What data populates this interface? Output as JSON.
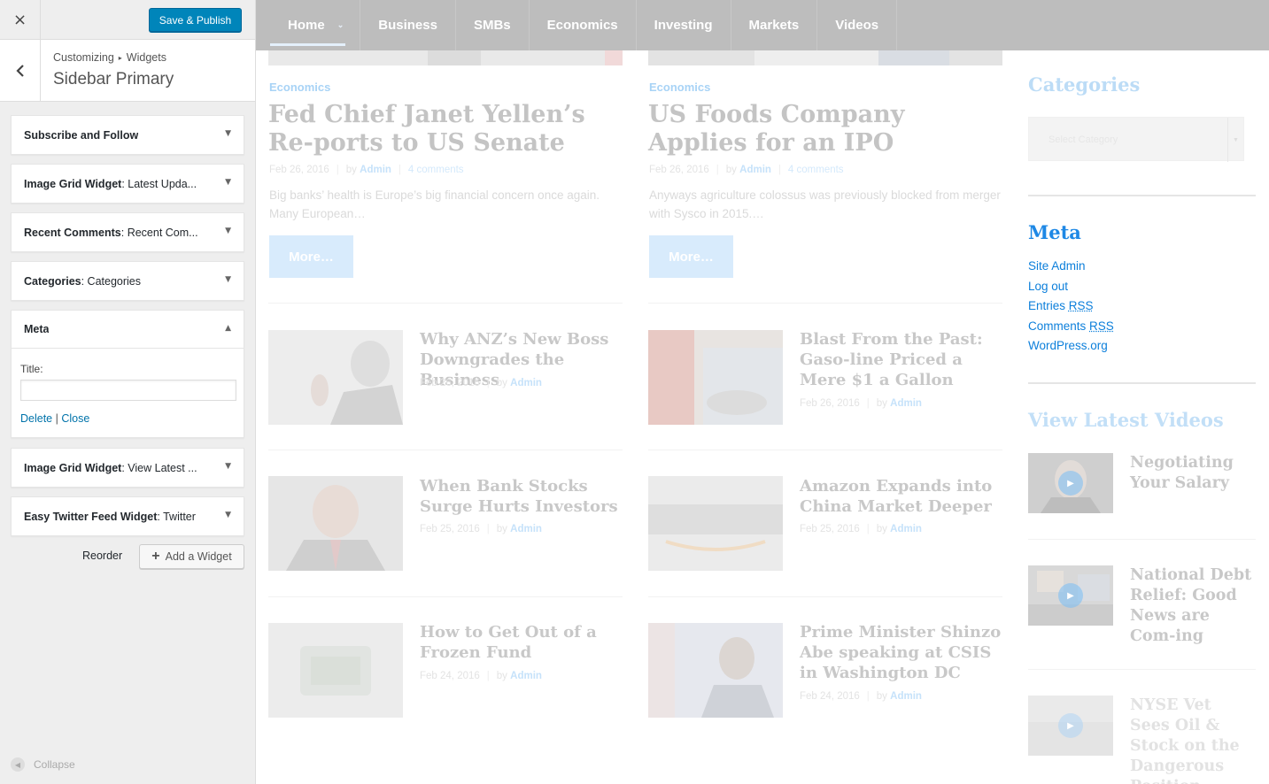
{
  "customizer": {
    "close_label": "×",
    "publish_label": "Save & Publish",
    "breadcrumb": {
      "root": "Customizing",
      "sep": "▸",
      "current": "Widgets"
    },
    "section_title": "Sidebar Primary",
    "widgets": [
      {
        "name": "Subscribe and Follow",
        "subtitle": ""
      },
      {
        "name": "Image Grid Widget",
        "subtitle": ": Latest Upda..."
      },
      {
        "name": "Recent Comments",
        "subtitle": ": Recent Com..."
      },
      {
        "name": "Categories",
        "subtitle": ": Categories"
      },
      {
        "name": "Meta",
        "subtitle": ""
      },
      {
        "name": "Image Grid Widget",
        "subtitle": ": View Latest ..."
      },
      {
        "name": "Easy Twitter Feed Widget",
        "subtitle": ": Twitter"
      }
    ],
    "meta_widget": {
      "title_label": "Title:",
      "title_value": "",
      "delete_label": "Delete",
      "divider": "|",
      "close_label": "Close"
    },
    "reorder_label": "Reorder",
    "add_widget_label": "Add a Widget",
    "collapse_label": "Collapse"
  },
  "nav": {
    "items": [
      "Home",
      "Business",
      "SMBs",
      "Economics",
      "Investing",
      "Markets",
      "Videos"
    ],
    "active": "Home"
  },
  "featured": [
    {
      "category": "Economics",
      "title": "Fed Chief Janet Yellen’s Re-ports to US Senate",
      "date": "Feb 26, 2016",
      "by": "by",
      "author": "Admin",
      "comments": "4 comments",
      "excerpt": "Big banks’ health is Europe’s big financial concern once again. Many European…",
      "more": "More…"
    },
    {
      "category": "Economics",
      "title": "US Foods Company Applies for an IPO",
      "date": "Feb 26, 2016",
      "by": "by",
      "author": "Admin",
      "comments": "4 comments",
      "excerpt": "Anyways agriculture colossus was previously blocked from merger with Sysco in 2015.…",
      "more": "More…"
    }
  ],
  "posts_left": [
    {
      "title": "Why ANZ’s New Boss Downgrades the Business",
      "date": "Feb 26, 2016",
      "by": "by",
      "author": "Admin"
    },
    {
      "title": "When Bank Stocks Surge Hurts Investors",
      "date": "Feb 25, 2016",
      "by": "by",
      "author": "Admin"
    },
    {
      "title": "How to Get Out of a Frozen Fund",
      "date": "Feb 24, 2016",
      "by": "by",
      "author": "Admin"
    }
  ],
  "posts_right": [
    {
      "title": "Blast From the Past: Gaso-line Priced a Mere $1 a Gallon",
      "date": "Feb 26, 2016",
      "by": "by",
      "author": "Admin"
    },
    {
      "title": "Amazon Expands into China Market Deeper",
      "date": "Feb 25, 2016",
      "by": "by",
      "author": "Admin"
    },
    {
      "title": "Prime Minister Shinzo Abe speaking at CSIS in Washington DC",
      "date": "Feb 24, 2016",
      "by": "by",
      "author": "Admin"
    }
  ],
  "sidebar": {
    "categories_title": "Categories",
    "select_placeholder": "Select Category",
    "meta_title": "Meta",
    "meta_links": [
      "Site Admin",
      "Log out"
    ],
    "meta_rss_links": [
      {
        "text": "Entries ",
        "abbr": "RSS"
      },
      {
        "text": "Comments ",
        "abbr": "RSS"
      }
    ],
    "meta_wp": "WordPress.org",
    "videos_title": "View Latest Videos",
    "videos": [
      "Negotiating Your Salary",
      "National Debt Relief: Good News are Com-ing",
      "NYSE Vet Sees Oil & Stock on the Dangerous Position"
    ]
  },
  "colors": {
    "publish": "#0085ba",
    "link": "#0073aa",
    "meta_link": "#0c7fdb",
    "nav_bg": "#bdbdbd",
    "faded_blue": "#a8d3f6"
  }
}
